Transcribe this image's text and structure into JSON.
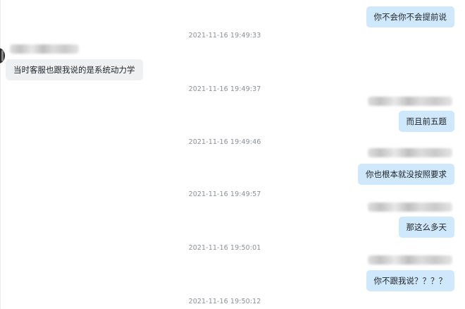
{
  "messages": [
    {
      "text": "你不会你不会提前说"
    },
    {
      "timestamp": "2021-11-16 19:49:33"
    },
    {
      "text": "当时客服也跟我说的是系统动力学"
    },
    {
      "timestamp": "2021-11-16 19:49:37"
    },
    {
      "text": "而且前五题"
    },
    {
      "timestamp": "2021-11-16 19:49:46"
    },
    {
      "text": "你也根本就没按照要求"
    },
    {
      "timestamp": "2021-11-16 19:49:57"
    },
    {
      "text": "那这么多天"
    },
    {
      "timestamp": "2021-11-16 19:50:01"
    },
    {
      "text": "你不跟我说？？？？"
    },
    {
      "timestamp": "2021-11-16 19:50:12"
    }
  ]
}
